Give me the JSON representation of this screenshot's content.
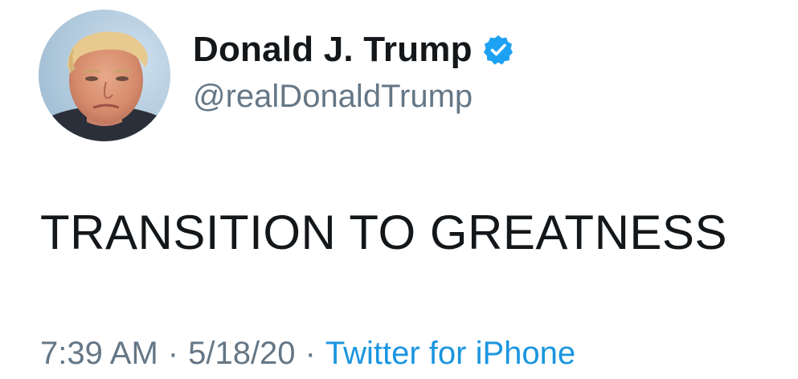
{
  "user": {
    "display_name": "Donald J. Trump",
    "handle": "@realDonaldTrump",
    "verified": true,
    "avatar_icon": "profile-photo"
  },
  "tweet": {
    "text": "TRANSITION TO GREATNESS",
    "time": "7:39 AM",
    "date": "5/18/20",
    "separator": "·",
    "source": "Twitter for iPhone"
  },
  "colors": {
    "text_primary": "#14171a",
    "text_secondary": "#657786",
    "link_blue": "#1b95e0",
    "verified_blue": "#1da1f2"
  }
}
